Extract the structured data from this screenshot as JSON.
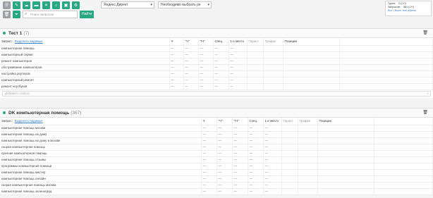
{
  "toolbar": {
    "buttons": [
      {
        "name": "list-icon",
        "glyph": "☰"
      },
      {
        "name": "tag-icon",
        "glyph": "✎"
      },
      {
        "name": "cloud-icon",
        "glyph": "☁"
      },
      {
        "name": "car-icon",
        "glyph": "▬"
      },
      {
        "name": "close-icon",
        "glyph": "✕"
      },
      {
        "name": "home-icon",
        "glyph": "⌂"
      },
      {
        "name": "briefcase-icon",
        "glyph": "▣"
      },
      {
        "name": "settings-icon",
        "glyph": "⚙"
      }
    ]
  },
  "engine_select": {
    "value": "Яндекс.Директ"
  },
  "region_select": {
    "value": "Необходимо выбрать ре"
  },
  "search": {
    "placeholder": "Поиск запросов",
    "button_label": "Найти"
  },
  "stats": {
    "groups_label": "Групп:",
    "groups_total": "2",
    "groups_green": "0",
    "groups_red": "0",
    "queries_label": "Запросов:",
    "queries_total": "381",
    "queries_green": "0",
    "queries_red": "0",
    "expand_link": "Все | Выкл. все группы"
  },
  "table_headers": {
    "query": "Запрос:",
    "select_all": "Выделить видимые",
    "freq": "Ч",
    "freq_q": "\"Ч\"",
    "freq_qe": "\"!Ч\"",
    "competition": "Спец.",
    "first_place": "1-е место",
    "guarantee": "Гарант.",
    "traffic": "Трафик",
    "positions": "Позиции"
  },
  "groups": [
    {
      "title": "Тест 1",
      "count": "(7)",
      "add_placeholder": "Добавить запрос",
      "rows": [
        "компьютерная помощь",
        "компьютерный сервис",
        "ремонт компьютеров",
        "обслуживание компьютеров",
        "настройка роутеров",
        "компьютерный ремонт",
        "ремонт ноутбуков"
      ]
    },
    {
      "title": "DK компьютерная помощь",
      "count": "(367)",
      "rows": [
        "компьютерная помощь москва",
        "компьютерная помощь на дому",
        "компьютерная помощь на дому в москве",
        "скорая компьютерная помощь",
        "срочная компьютерная помощь",
        "компьютерная помощь отзывы",
        "программы компьютерной помощи",
        "компьютерная помощь мастер",
        "компьютерная помощь онлайн",
        "скорая компьютерная помощь москва",
        "компьютерная помощь зеленоград"
      ]
    }
  ],
  "dash": "—"
}
